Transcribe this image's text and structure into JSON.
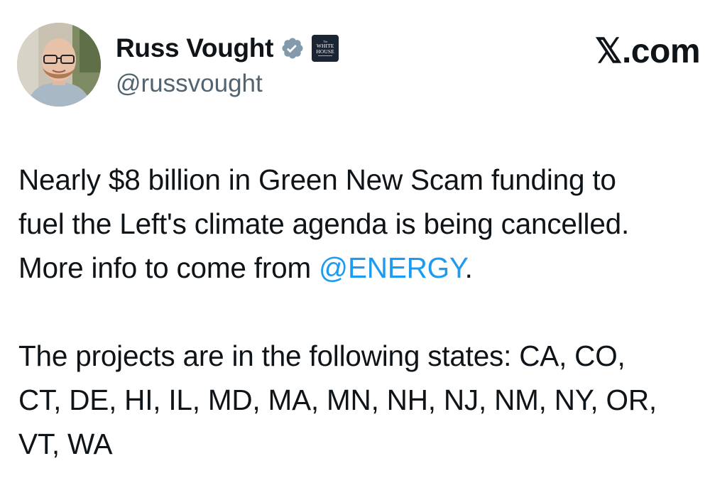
{
  "author": {
    "display_name": "Russ Vought",
    "handle": "@russvought",
    "verified_icon": "verified-badge-icon",
    "affiliation_badge": {
      "icon": "white-house-badge-icon",
      "text_top": "The",
      "text_line1": "WHITE",
      "text_line2": "HOUSE"
    }
  },
  "site_label": "𝕏.com",
  "tweet": {
    "paragraph1": {
      "line1": "Nearly $8 billion in Green New Scam funding to",
      "line2": "fuel the Left's climate agenda is being cancelled.",
      "line3_prefix": "More info to come from ",
      "mention": "@ENERGY",
      "line3_suffix": "."
    },
    "paragraph2": {
      "line1": "The projects are in the following states: CA, CO,",
      "line2": "CT, DE, HI, IL, MD, MA, MN, NH, NJ, NM, NY, OR,",
      "line3": "VT, WA"
    }
  },
  "colors": {
    "text": "#0f1419",
    "secondary_text": "#536471",
    "link": "#1d9bf0",
    "verified_badge": "#829aab",
    "affiliation_badge_bg": "#1b2433"
  }
}
